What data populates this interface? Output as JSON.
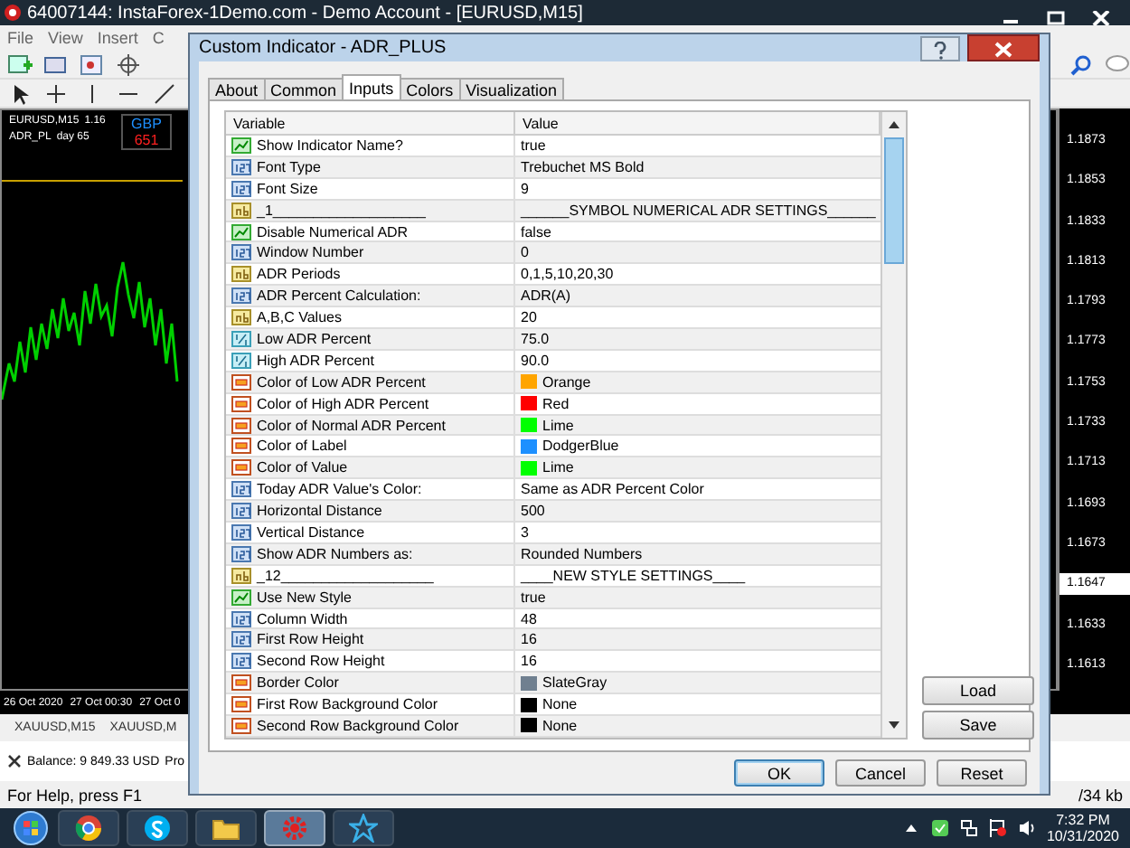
{
  "app_window": {
    "title": "64007144: InstaForex-1Demo.com - Demo Account - [EURUSD,M15]"
  },
  "menu": [
    "File",
    "View",
    "Insert",
    "C"
  ],
  "chart": {
    "symbol": "EURUSD,M15",
    "price": "1.16",
    "adr_label": "ADR_PL",
    "adr_today": "day 65",
    "panel_headers": [
      "GBP"
    ],
    "panel_values": [
      "651"
    ],
    "price_axis": [
      {
        "label": "1.1873",
        "current": false
      },
      {
        "label": "1.1853",
        "current": false
      },
      {
        "label": "1.1833",
        "current": false
      },
      {
        "label": "1.1813",
        "current": false
      },
      {
        "label": "1.1793",
        "current": false
      },
      {
        "label": "1.1773",
        "current": false
      },
      {
        "label": "1.1753",
        "current": false
      },
      {
        "label": "1.1733",
        "current": false
      },
      {
        "label": "1.1713",
        "current": false
      },
      {
        "label": "1.1693",
        "current": false
      },
      {
        "label": "1.1673",
        "current": false
      },
      {
        "label": "1.1647",
        "current": true
      },
      {
        "label": "1.1633",
        "current": false
      },
      {
        "label": "1.1613",
        "current": false
      }
    ],
    "time_axis": [
      "26 Oct 2020",
      "27 Oct 00:30",
      "27 Oct 0"
    ]
  },
  "chart_tabs": [
    "XAUUSD,M15",
    "XAUUSD,M"
  ],
  "terminal": {
    "balance": "Balance: 9 849.33 USD",
    "cut_text": "Pro"
  },
  "status_bar": {
    "help": "For Help, press F1",
    "traffic": "/34 kb"
  },
  "taskbar": {
    "apps": [
      {
        "kind": "browser",
        "selected": false
      },
      {
        "kind": "chat",
        "selected": false
      },
      {
        "kind": "folder",
        "selected": false
      },
      {
        "kind": "gear",
        "selected": true
      },
      {
        "kind": "star",
        "selected": false
      }
    ],
    "time": "7:32 PM",
    "date": "10/31/2020"
  },
  "dialog": {
    "title": "Custom Indicator - ADR_PLUS",
    "tabs": [
      {
        "label": "About",
        "selected": false
      },
      {
        "label": "Common",
        "selected": false
      },
      {
        "label": "Inputs",
        "selected": true
      },
      {
        "label": "Colors",
        "selected": false
      },
      {
        "label": "Visualization",
        "selected": false
      }
    ],
    "columns": [
      "Variable",
      "Value"
    ],
    "rows": [
      {
        "kind": "bool",
        "variable": "Show Indicator Name?",
        "value": "true"
      },
      {
        "kind": "int",
        "variable": "Font Type",
        "value": "Trebuchet MS Bold"
      },
      {
        "kind": "int",
        "variable": "Font Size",
        "value": "9"
      },
      {
        "kind": "string",
        "variable": "_1___________________",
        "value": "______SYMBOL NUMERICAL ADR SETTINGS______"
      },
      {
        "kind": "bool",
        "variable": "Disable Numerical ADR",
        "value": "false"
      },
      {
        "kind": "int",
        "variable": "Window Number",
        "value": "0"
      },
      {
        "kind": "string",
        "variable": "ADR Periods",
        "value": "0,1,5,10,20,30"
      },
      {
        "kind": "int",
        "variable": "ADR Percent Calculation:",
        "value": "ADR(A)"
      },
      {
        "kind": "string",
        "variable": "A,B,C Values",
        "value": "20"
      },
      {
        "kind": "double",
        "variable": "Low ADR Percent",
        "value": "75.0"
      },
      {
        "kind": "double",
        "variable": "High ADR Percent",
        "value": "90.0"
      },
      {
        "kind": "color",
        "variable": "Color of Low ADR Percent",
        "value": "Orange",
        "color": "#ffa500"
      },
      {
        "kind": "color",
        "variable": "Color of High ADR Percent",
        "value": "Red",
        "color": "#ff0000"
      },
      {
        "kind": "color",
        "variable": "Color of Normal ADR Percent",
        "value": "Lime",
        "color": "#00ff00"
      },
      {
        "kind": "color",
        "variable": "Color of Label",
        "value": "DodgerBlue",
        "color": "#1e90ff"
      },
      {
        "kind": "color",
        "variable": "Color of Value",
        "value": "Lime",
        "color": "#00ff00"
      },
      {
        "kind": "int",
        "variable": "Today ADR Value's Color:",
        "value": "Same as ADR Percent Color"
      },
      {
        "kind": "int",
        "variable": "Horizontal Distance",
        "value": "500"
      },
      {
        "kind": "int",
        "variable": "Vertical Distance",
        "value": "3"
      },
      {
        "kind": "int",
        "variable": "Show ADR Numbers as:",
        "value": "Rounded Numbers"
      },
      {
        "kind": "string",
        "variable": "_12___________________",
        "value": "____NEW STYLE SETTINGS____"
      },
      {
        "kind": "bool",
        "variable": "Use New Style",
        "value": "true"
      },
      {
        "kind": "int",
        "variable": "Column Width",
        "value": "48"
      },
      {
        "kind": "int",
        "variable": "First Row Height",
        "value": "16"
      },
      {
        "kind": "int",
        "variable": "Second Row Height",
        "value": "16"
      },
      {
        "kind": "color",
        "variable": "Border Color",
        "value": "SlateGray",
        "color": "#708090"
      },
      {
        "kind": "color",
        "variable": "First Row Background Color",
        "value": "None",
        "color": "#000000"
      },
      {
        "kind": "color",
        "variable": "Second Row Background Color",
        "value": "None",
        "color": "#000000"
      }
    ],
    "side_buttons": [
      "Load",
      "Save"
    ],
    "buttons": [
      {
        "label": "OK",
        "default": true
      },
      {
        "label": "Cancel",
        "default": false
      },
      {
        "label": "Reset",
        "default": false
      }
    ]
  }
}
